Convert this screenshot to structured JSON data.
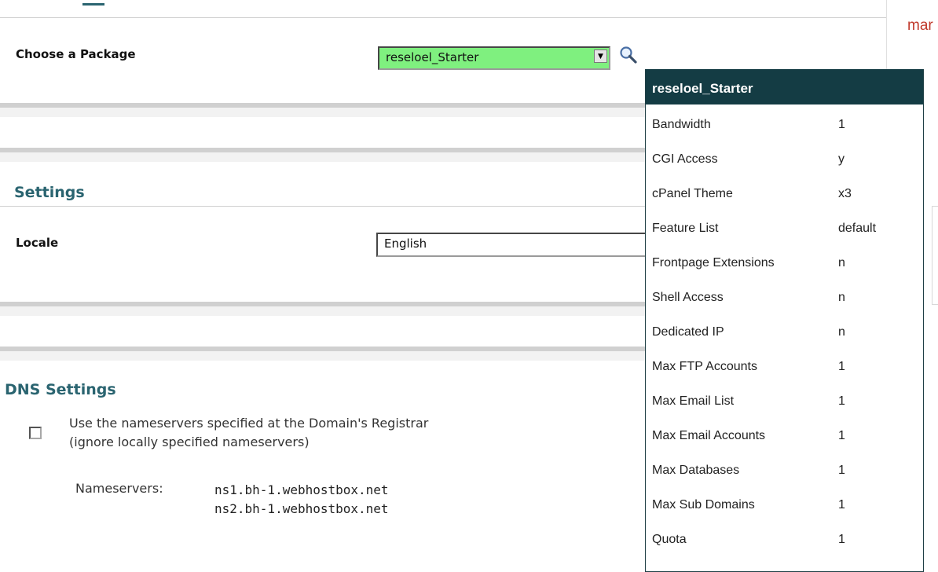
{
  "package": {
    "label": "Choose a Package",
    "selected": "reseloel_Starter"
  },
  "settings": {
    "title": "Settings",
    "locale_label": "Locale",
    "locale_value": "English"
  },
  "dns": {
    "title": "DNS Settings",
    "checkbox_line1": "Use the nameservers specified at the Domain's Registrar",
    "checkbox_line2": "(ignore locally specified nameservers)",
    "nameservers_label": "Nameservers:",
    "ns1": "ns1.bh-1.webhostbox.net",
    "ns2": "ns2.bh-1.webhostbox.net"
  },
  "popup": {
    "title": "reseloel_Starter",
    "rows": [
      {
        "key": "Bandwidth",
        "value": "1"
      },
      {
        "key": "CGI Access",
        "value": "y"
      },
      {
        "key": "cPanel Theme",
        "value": "x3"
      },
      {
        "key": "Feature List",
        "value": "default"
      },
      {
        "key": "Frontpage Extensions",
        "value": "n"
      },
      {
        "key": "Shell Access",
        "value": "n"
      },
      {
        "key": "Dedicated IP",
        "value": "n"
      },
      {
        "key": "Max FTP Accounts",
        "value": "1"
      },
      {
        "key": "Max Email List",
        "value": "1"
      },
      {
        "key": "Max Email Accounts",
        "value": "1"
      },
      {
        "key": "Max Databases",
        "value": "1"
      },
      {
        "key": "Max Sub Domains",
        "value": "1"
      },
      {
        "key": "Quota",
        "value": "1"
      }
    ]
  },
  "right_edge": {
    "text": "mar"
  },
  "colors": {
    "package_select_bg": "#7ff07f",
    "section_title": "#2a6470",
    "popup_header": "#143c44"
  },
  "icons": {
    "magnifier": "magnifier-icon",
    "dropdown": "chevron-down-icon"
  }
}
